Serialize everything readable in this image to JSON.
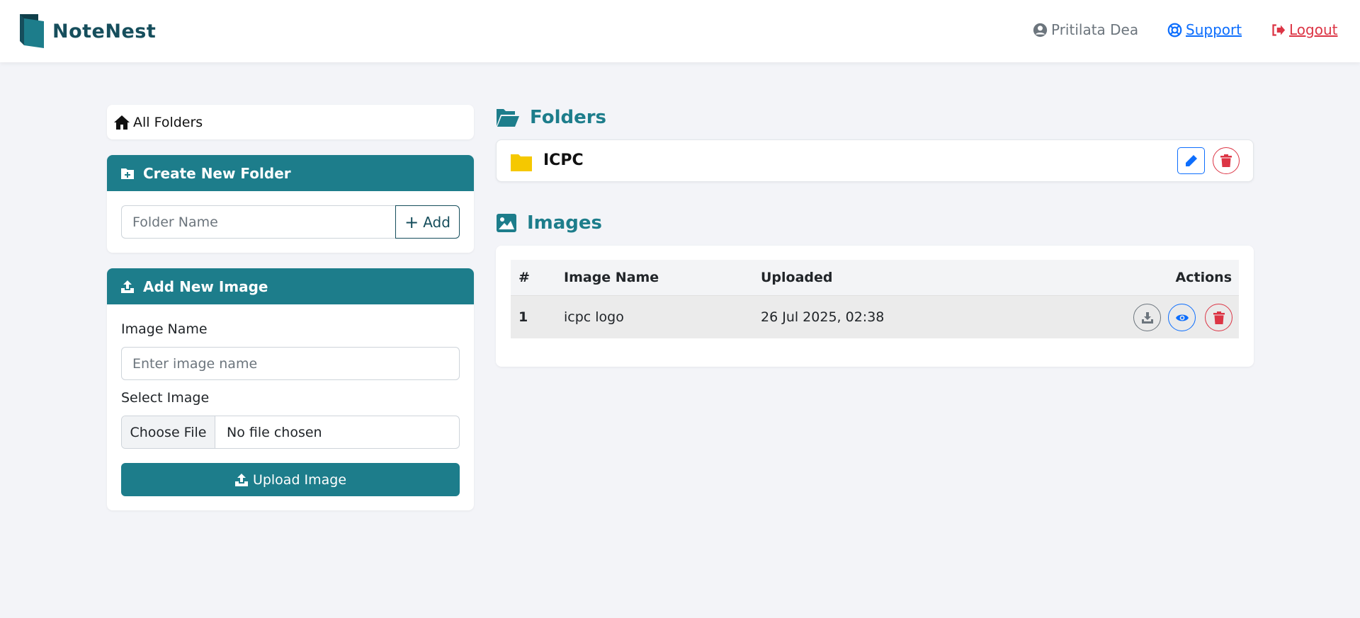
{
  "brand": {
    "name": "NoteNest"
  },
  "nav": {
    "user": "Pritilata Dea",
    "support": "Support",
    "logout": "Logout"
  },
  "sidebar": {
    "all_folders": "All Folders",
    "create_folder": {
      "title": "Create New Folder",
      "placeholder": "Folder Name",
      "add_label": "Add"
    },
    "add_image": {
      "title": "Add New Image",
      "name_label": "Image Name",
      "name_placeholder": "Enter image name",
      "select_label": "Select Image",
      "choose_file": "Choose File",
      "no_file": "No file chosen",
      "upload_label": "Upload Image"
    }
  },
  "folders": {
    "title": "Folders",
    "items": [
      {
        "name": "ICPC"
      }
    ]
  },
  "images": {
    "title": "Images",
    "columns": [
      "#",
      "Image Name",
      "Uploaded",
      "Actions"
    ],
    "rows": [
      {
        "index": "1",
        "name": "icpc logo",
        "uploaded": "26 Jul 2025, 02:38"
      }
    ]
  },
  "colors": {
    "accent": "#1d7d8b",
    "brand": "#164e5c",
    "link": "#0d6efd",
    "danger": "#dc3545",
    "folder": "#f5c800"
  }
}
